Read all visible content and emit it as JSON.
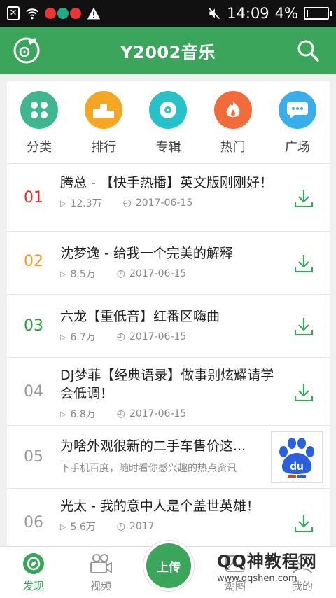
{
  "status_bar": {
    "time": "14:09",
    "battery": "4%",
    "battery_level": 0.04
  },
  "header": {
    "title": "Y2002音乐"
  },
  "categories": [
    {
      "label": "分类",
      "color": "#3fb68e",
      "icon": "grid-icon"
    },
    {
      "label": "排行",
      "color": "#f5a623",
      "icon": "podium-icon"
    },
    {
      "label": "专辑",
      "color": "#26c1c9",
      "icon": "disc-icon"
    },
    {
      "label": "热门",
      "color": "#f26b3a",
      "icon": "flame-icon"
    },
    {
      "label": "广场",
      "color": "#3aaee8",
      "icon": "chat-icon"
    }
  ],
  "songs": [
    {
      "rank": "01",
      "title": "腾总 - 【快手热播】英文版刚刚好！",
      "plays": "12.3万",
      "date": "2017-06-15",
      "rank_color": "#e0312f"
    },
    {
      "rank": "02",
      "title": "沈梦逸 - 给我一个完美的解释",
      "plays": "8.5万",
      "date": "2017-06-15",
      "rank_color": "#f59a23"
    },
    {
      "rank": "03",
      "title": "六龙【重低音】红番区嗨曲",
      "plays": "6.7万",
      "date": "2017-06-15",
      "rank_color": "#2f9a3a"
    },
    {
      "rank": "04",
      "title": "DJ梦菲【经典语录】做事别炫耀请学会低调！",
      "plays": "6.8万",
      "date": "2017-06-15",
      "rank_color": "#999999"
    },
    {
      "rank": "05",
      "title": "为啥外观很新的二手车售价这...",
      "subtitle": "下手机百度，随时看你感兴趣的热点资讯",
      "rank_color": "#999999",
      "ad_logo": "du"
    },
    {
      "rank": "06",
      "title": "光太 - 我的意中人是个盖世英雄！",
      "plays": "5.6万",
      "date": "2017",
      "rank_color": "#999999"
    }
  ],
  "bottom_nav": [
    {
      "label": "发现",
      "icon": "discover-icon",
      "active": true
    },
    {
      "label": "视频",
      "icon": "video-icon",
      "active": false
    },
    {
      "label": "上传",
      "icon": "upload-icon"
    },
    {
      "label": "潮图",
      "icon": "image-icon",
      "active": false
    },
    {
      "label": "我的",
      "icon": "profile-icon",
      "active": false
    }
  ],
  "watermark": {
    "main": "QQ神教程网",
    "url": "www.qqshen.com"
  }
}
